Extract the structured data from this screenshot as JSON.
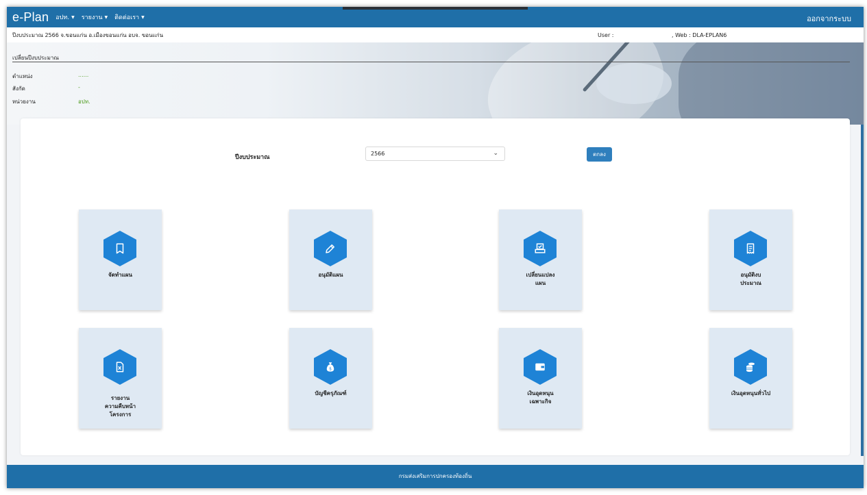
{
  "navbar": {
    "brand": "e-Plan",
    "menu": [
      {
        "label": "อปท."
      },
      {
        "label": "รายงาน"
      },
      {
        "label": "ติดต่อเรา"
      }
    ],
    "logout": "ออกจากระบบ"
  },
  "infobar": {
    "location": "ปีงบประมาณ 2566  จ.ขอนแก่น อ.เมืองขอนแก่น อบจ. ขอนแก่น",
    "user_label": "User :",
    "web_label": ", Web : DLA-EPLAN6"
  },
  "hero": {
    "title": "เปลี่ยนปีงบประมาณ",
    "rows": [
      {
        "label": "ตำแหน่ง",
        "value": "......"
      },
      {
        "label": "สังกัด",
        "value": "-"
      },
      {
        "label": "หน่วยงาน",
        "value": "อปท."
      }
    ]
  },
  "year_form": {
    "label": "ปีงบประมาณ",
    "selected": "2566",
    "submit": "ตกลง"
  },
  "cards": [
    {
      "lines": [
        "จัดทำแผน"
      ],
      "icon": "bookmark-icon"
    },
    {
      "lines": [
        "อนุมัติแผน"
      ],
      "icon": "pencil-icon"
    },
    {
      "lines": [
        "เปลี่ยนแปลง",
        "แผน"
      ],
      "icon": "printer-check-icon"
    },
    {
      "lines": [
        "อนุมัติงบ",
        "ประมาณ"
      ],
      "icon": "receipt-icon"
    },
    {
      "lines": [
        "รายงาน",
        "ความคืบหน้า",
        "โครงการ"
      ],
      "icon": "excel-file-icon"
    },
    {
      "lines": [
        "บัญชีครุภัณฑ์"
      ],
      "icon": "money-bag-icon"
    },
    {
      "lines": [
        "เงินอุดหนุน",
        "เฉพาะกิจ"
      ],
      "icon": "wallet-icon"
    },
    {
      "lines": [
        "เงินอุดหนุนทั่วไป"
      ],
      "icon": "coins-icon"
    }
  ],
  "footer": "กรมส่งเสริมการปกครองท้องถิ่น",
  "colors": {
    "navbar": "#1f6fa8",
    "icon_hex": "#1e83d6",
    "card_bg": "#dfe9f3",
    "ok_button": "#2f7fbd",
    "value_green": "#4a9a1a"
  }
}
